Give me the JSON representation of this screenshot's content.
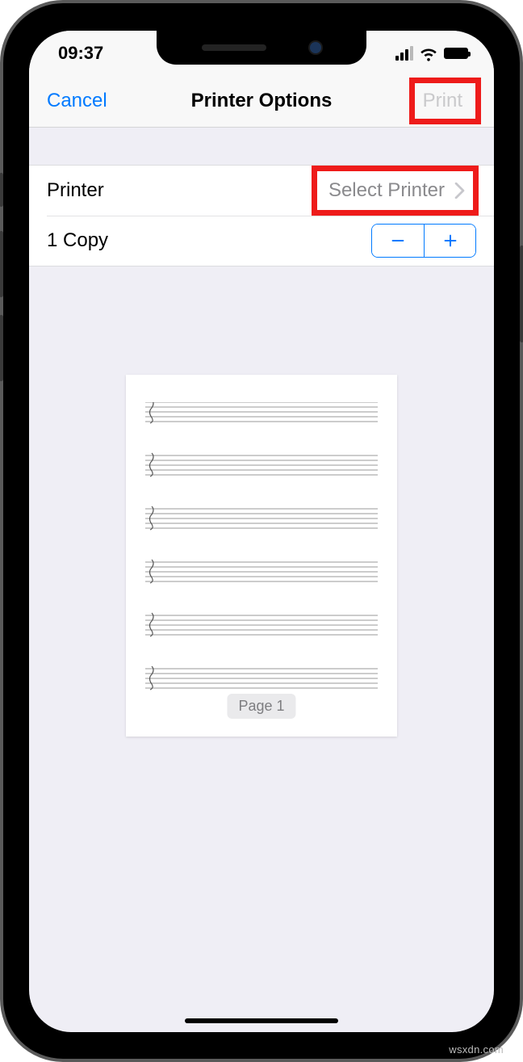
{
  "status": {
    "time": "09:37"
  },
  "nav": {
    "cancel": "Cancel",
    "title": "Printer Options",
    "print": "Print"
  },
  "settings": {
    "printer_label": "Printer",
    "printer_value": "Select Printer",
    "copies_label": "1 Copy"
  },
  "preview": {
    "page_label": "Page 1"
  },
  "watermark": "wsxdn.com"
}
